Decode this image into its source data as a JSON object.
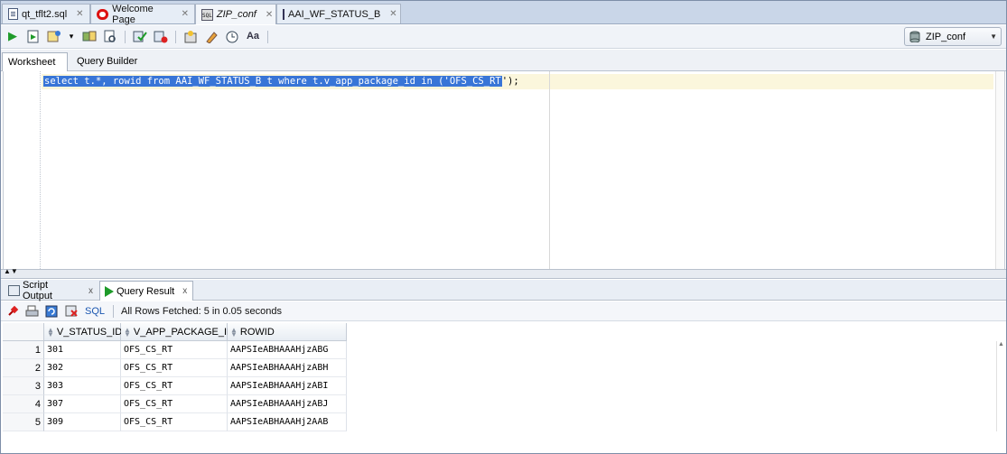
{
  "doc_tabs": [
    {
      "label": "qt_tflt2.sql",
      "icon": "sql-file-icon"
    },
    {
      "label": "Welcome Page",
      "icon": "oracle-icon"
    },
    {
      "label": "ZIP_conf",
      "icon": "sql-worksheet-icon",
      "active": true
    },
    {
      "label": "AAI_WF_STATUS_B",
      "icon": "table-icon"
    }
  ],
  "toolbar": {
    "icons": [
      "run-statement-icon",
      "run-script-icon",
      "autotrace-icon",
      "dropdown-icon",
      "explain-plan-icon",
      "sql-tuning-icon",
      "commit-icon",
      "rollback-icon",
      "unshared-sql-icon",
      "clear-icon",
      "sql-history-icon",
      "format-icon"
    ],
    "connection": "ZIP_conf"
  },
  "worksheet_tabs": [
    "Worksheet",
    "Query Builder"
  ],
  "editor": {
    "sql_selected": "select t.*, rowid from AAI_WF_STATUS_B t where t.v_app_package_id in ('OFS_CS_RT",
    "sql_tail": "');"
  },
  "result_tabs": [
    {
      "label": "Script Output",
      "close": "x"
    },
    {
      "label": "Query Result",
      "close": "x",
      "active": true
    }
  ],
  "results_toolbar": {
    "sql_link": "SQL",
    "status": "All Rows Fetched: 5 in 0.05 seconds"
  },
  "grid": {
    "columns": [
      "V_STATUS_ID",
      "V_APP_PACKAGE_ID",
      "ROWID"
    ],
    "rows": [
      {
        "n": "1",
        "cells": [
          "301",
          "OFS_CS_RT",
          "AAPSIeABHAAAHjzABG"
        ]
      },
      {
        "n": "2",
        "cells": [
          "302",
          "OFS_CS_RT",
          "AAPSIeABHAAAHjzABH"
        ]
      },
      {
        "n": "3",
        "cells": [
          "303",
          "OFS_CS_RT",
          "AAPSIeABHAAAHjzABI"
        ]
      },
      {
        "n": "4",
        "cells": [
          "307",
          "OFS_CS_RT",
          "AAPSIeABHAAAHjzABJ"
        ]
      },
      {
        "n": "5",
        "cells": [
          "309",
          "OFS_CS_RT",
          "AAPSIeABHAAAHj2AAB"
        ]
      }
    ]
  }
}
